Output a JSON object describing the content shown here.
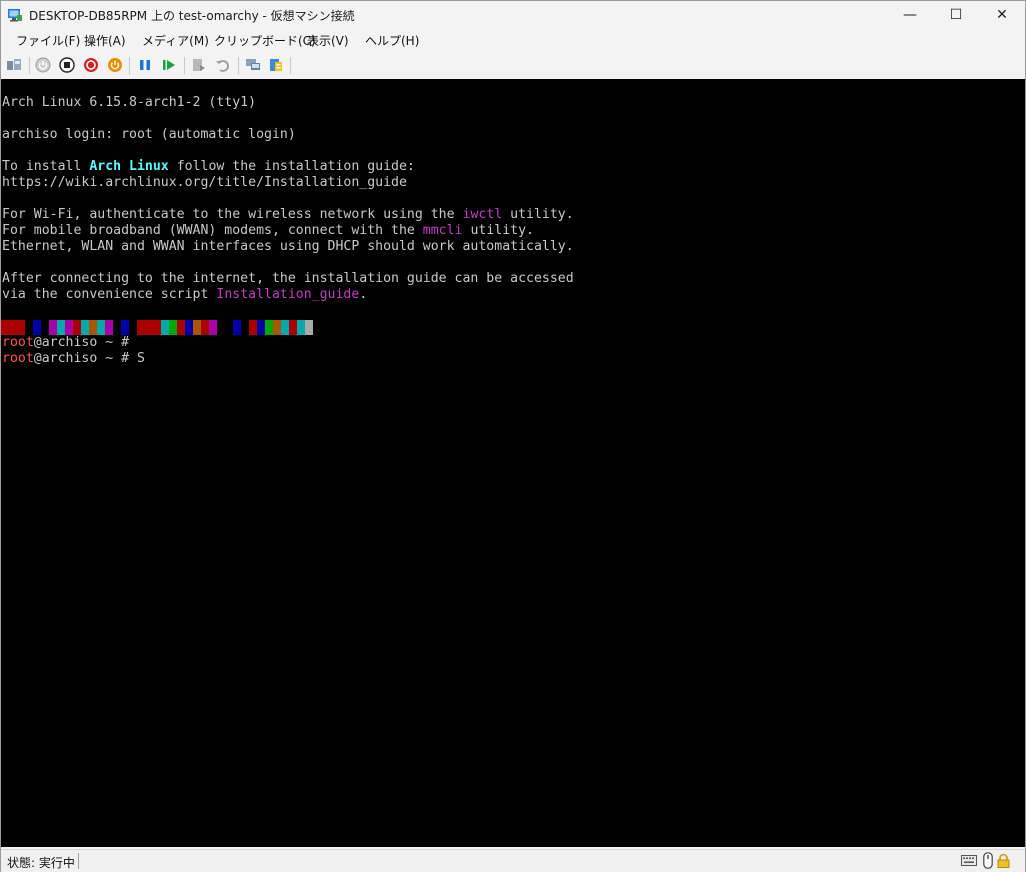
{
  "window": {
    "title": "DESKTOP-DB85RPM 上の test-omarchy - 仮想マシン接続",
    "controls": {
      "minimize": "—",
      "maximize": "☐",
      "close": "✕"
    }
  },
  "menu": {
    "items": [
      "ファイル(F)",
      "操作(A)",
      "メディア(M)",
      "クリップボード(C)",
      "表示(V)",
      "ヘルプ(H)"
    ]
  },
  "toolbar": {
    "icons": [
      "ctrl-alt-del-icon",
      "start-icon",
      "turn-off-icon",
      "shutdown-icon",
      "save-icon",
      "pause-icon",
      "resume-icon",
      "checkpoint-icon",
      "revert-icon",
      "enhanced-session-icon",
      "share-icon"
    ]
  },
  "terminal": {
    "line1": "Arch Linux 6.15.8-arch1-2 (tty1)",
    "line2": "archiso login: root (automatic login)",
    "line3a": "To install ",
    "line3b": "Arch Linux",
    "line3c": " follow the installation guide:",
    "line4": "https://wiki.archlinux.org/title/Installation_guide",
    "line5a": "For Wi-Fi, authenticate to the wireless network using the ",
    "line5b": "iwctl",
    "line5c": " utility.",
    "line6a": "For mobile broadband (WWAN) modems, connect with the ",
    "line6b": "mmcli",
    "line6c": " utility.",
    "line7": "Ethernet, WLAN and WWAN interfaces using DHCP should work automatically.",
    "line8": "After connecting to the internet, the installation guide can be accessed",
    "line9a": "via the convenience script ",
    "line9b": "Installation_guide",
    "line9c": ".",
    "prompt_user": "root",
    "prompt_rest": "@archiso ~ #",
    "prompt2_rest": "@archiso ~ # S"
  },
  "color_bars": [
    "#aa0000",
    "#aa0000",
    "#aa0000",
    "#000000",
    "#0000aa",
    "#000000",
    "#aa00aa",
    "#00aaaa",
    "#aa00aa",
    "#aa0000",
    "#00aaaa",
    "#aa5500",
    "#00aaaa",
    "#aa00aa",
    "#000000",
    "#0000aa",
    "#000000",
    "#aa0000",
    "#aa0000",
    "#aa0000",
    "#00aaaa",
    "#00aa00",
    "#aa0000",
    "#0000aa",
    "#aa5500",
    "#aa0000",
    "#aa00aa",
    "#000000",
    "#000000",
    "#0000aa",
    "#000000",
    "#aa0000",
    "#0000aa",
    "#00aa00",
    "#aa5500",
    "#00aaaa",
    "#aa0000",
    "#00aaaa",
    "#aaaaaa"
  ],
  "status": {
    "text": "状態: 実行中"
  }
}
